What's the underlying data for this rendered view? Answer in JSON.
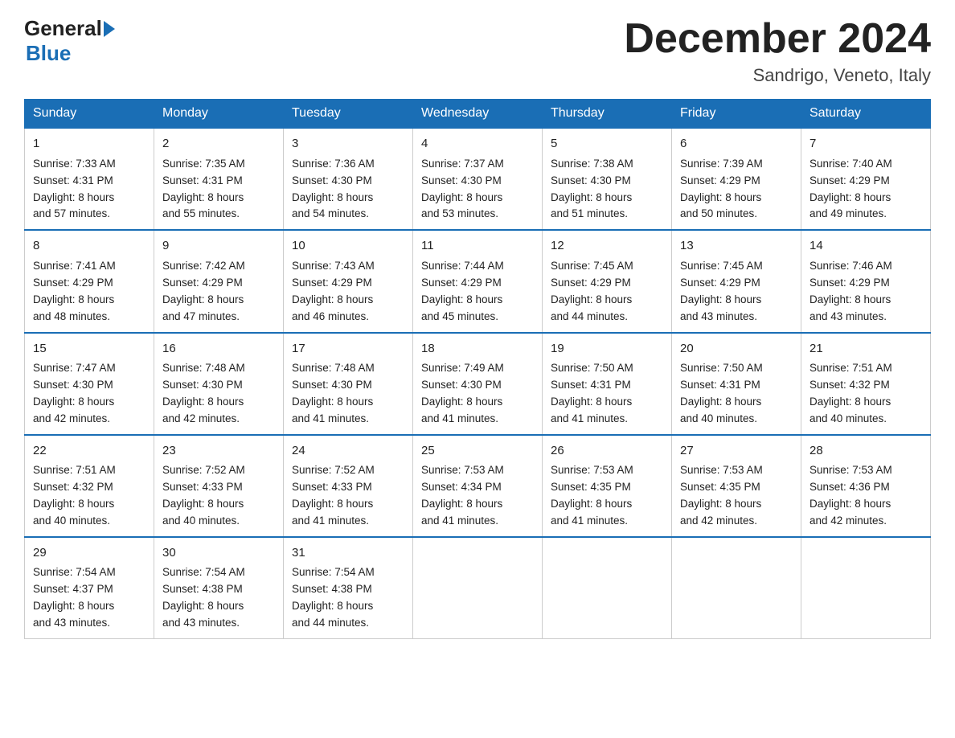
{
  "header": {
    "logo_general": "General",
    "logo_blue": "Blue",
    "month_title": "December 2024",
    "subtitle": "Sandrigo, Veneto, Italy"
  },
  "days_of_week": [
    "Sunday",
    "Monday",
    "Tuesday",
    "Wednesday",
    "Thursday",
    "Friday",
    "Saturday"
  ],
  "weeks": [
    [
      {
        "day": "1",
        "sunrise": "7:33 AM",
        "sunset": "4:31 PM",
        "daylight": "8 hours and 57 minutes."
      },
      {
        "day": "2",
        "sunrise": "7:35 AM",
        "sunset": "4:31 PM",
        "daylight": "8 hours and 55 minutes."
      },
      {
        "day": "3",
        "sunrise": "7:36 AM",
        "sunset": "4:30 PM",
        "daylight": "8 hours and 54 minutes."
      },
      {
        "day": "4",
        "sunrise": "7:37 AM",
        "sunset": "4:30 PM",
        "daylight": "8 hours and 53 minutes."
      },
      {
        "day": "5",
        "sunrise": "7:38 AM",
        "sunset": "4:30 PM",
        "daylight": "8 hours and 51 minutes."
      },
      {
        "day": "6",
        "sunrise": "7:39 AM",
        "sunset": "4:29 PM",
        "daylight": "8 hours and 50 minutes."
      },
      {
        "day": "7",
        "sunrise": "7:40 AM",
        "sunset": "4:29 PM",
        "daylight": "8 hours and 49 minutes."
      }
    ],
    [
      {
        "day": "8",
        "sunrise": "7:41 AM",
        "sunset": "4:29 PM",
        "daylight": "8 hours and 48 minutes."
      },
      {
        "day": "9",
        "sunrise": "7:42 AM",
        "sunset": "4:29 PM",
        "daylight": "8 hours and 47 minutes."
      },
      {
        "day": "10",
        "sunrise": "7:43 AM",
        "sunset": "4:29 PM",
        "daylight": "8 hours and 46 minutes."
      },
      {
        "day": "11",
        "sunrise": "7:44 AM",
        "sunset": "4:29 PM",
        "daylight": "8 hours and 45 minutes."
      },
      {
        "day": "12",
        "sunrise": "7:45 AM",
        "sunset": "4:29 PM",
        "daylight": "8 hours and 44 minutes."
      },
      {
        "day": "13",
        "sunrise": "7:45 AM",
        "sunset": "4:29 PM",
        "daylight": "8 hours and 43 minutes."
      },
      {
        "day": "14",
        "sunrise": "7:46 AM",
        "sunset": "4:29 PM",
        "daylight": "8 hours and 43 minutes."
      }
    ],
    [
      {
        "day": "15",
        "sunrise": "7:47 AM",
        "sunset": "4:30 PM",
        "daylight": "8 hours and 42 minutes."
      },
      {
        "day": "16",
        "sunrise": "7:48 AM",
        "sunset": "4:30 PM",
        "daylight": "8 hours and 42 minutes."
      },
      {
        "day": "17",
        "sunrise": "7:48 AM",
        "sunset": "4:30 PM",
        "daylight": "8 hours and 41 minutes."
      },
      {
        "day": "18",
        "sunrise": "7:49 AM",
        "sunset": "4:30 PM",
        "daylight": "8 hours and 41 minutes."
      },
      {
        "day": "19",
        "sunrise": "7:50 AM",
        "sunset": "4:31 PM",
        "daylight": "8 hours and 41 minutes."
      },
      {
        "day": "20",
        "sunrise": "7:50 AM",
        "sunset": "4:31 PM",
        "daylight": "8 hours and 40 minutes."
      },
      {
        "day": "21",
        "sunrise": "7:51 AM",
        "sunset": "4:32 PM",
        "daylight": "8 hours and 40 minutes."
      }
    ],
    [
      {
        "day": "22",
        "sunrise": "7:51 AM",
        "sunset": "4:32 PM",
        "daylight": "8 hours and 40 minutes."
      },
      {
        "day": "23",
        "sunrise": "7:52 AM",
        "sunset": "4:33 PM",
        "daylight": "8 hours and 40 minutes."
      },
      {
        "day": "24",
        "sunrise": "7:52 AM",
        "sunset": "4:33 PM",
        "daylight": "8 hours and 41 minutes."
      },
      {
        "day": "25",
        "sunrise": "7:53 AM",
        "sunset": "4:34 PM",
        "daylight": "8 hours and 41 minutes."
      },
      {
        "day": "26",
        "sunrise": "7:53 AM",
        "sunset": "4:35 PM",
        "daylight": "8 hours and 41 minutes."
      },
      {
        "day": "27",
        "sunrise": "7:53 AM",
        "sunset": "4:35 PM",
        "daylight": "8 hours and 42 minutes."
      },
      {
        "day": "28",
        "sunrise": "7:53 AM",
        "sunset": "4:36 PM",
        "daylight": "8 hours and 42 minutes."
      }
    ],
    [
      {
        "day": "29",
        "sunrise": "7:54 AM",
        "sunset": "4:37 PM",
        "daylight": "8 hours and 43 minutes."
      },
      {
        "day": "30",
        "sunrise": "7:54 AM",
        "sunset": "4:38 PM",
        "daylight": "8 hours and 43 minutes."
      },
      {
        "day": "31",
        "sunrise": "7:54 AM",
        "sunset": "4:38 PM",
        "daylight": "8 hours and 44 minutes."
      },
      null,
      null,
      null,
      null
    ]
  ]
}
